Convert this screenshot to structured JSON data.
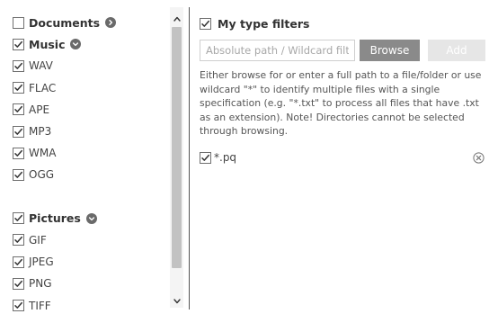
{
  "categories": {
    "documents": {
      "label": "Documents",
      "checked": false,
      "expand_icon": "chevron-right-circle-icon"
    },
    "music": {
      "label": "Music",
      "checked": true,
      "expand_icon": "chevron-down-circle-icon",
      "items": [
        {
          "label": "WAV",
          "checked": true
        },
        {
          "label": "FLAC",
          "checked": true
        },
        {
          "label": "APE",
          "checked": true
        },
        {
          "label": "MP3",
          "checked": true
        },
        {
          "label": "WMA",
          "checked": true
        },
        {
          "label": "OGG",
          "checked": true
        }
      ]
    },
    "pictures": {
      "label": "Pictures",
      "checked": true,
      "expand_icon": "chevron-down-circle-icon",
      "items": [
        {
          "label": "GIF",
          "checked": true
        },
        {
          "label": "JPEG",
          "checked": true
        },
        {
          "label": "PNG",
          "checked": true
        },
        {
          "label": "TIFF",
          "checked": true
        }
      ]
    }
  },
  "my_type_filters": {
    "label": "My type filters",
    "checked": true,
    "path_input": {
      "value": "",
      "placeholder": "Absolute path / Wildcard filter"
    },
    "browse_label": "Browse",
    "add_label": "Add",
    "add_enabled": false,
    "help_text": "Either browse for or enter a full path to a file/folder or use wildcard \"*\" to identify multiple files with a single specification (e.g. \"*.txt\" to process all files that have .txt as an extension). Note! Directories cannot be selected through browsing.",
    "filters": [
      {
        "label": "*.pq",
        "checked": true
      }
    ]
  },
  "colors": {
    "browse_button": "#8a8a8a",
    "add_button_disabled": "#e6e6e6",
    "checkmark": "#333333",
    "toggle_icon": "#6a6a6a",
    "divider": "#555555"
  }
}
